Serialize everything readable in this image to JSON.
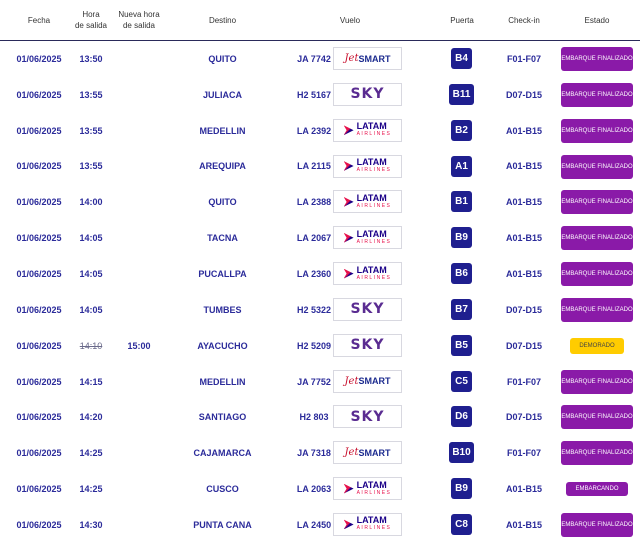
{
  "header": {
    "fecha": "Fecha",
    "hora": "Hora\nde salida",
    "nueva_hora": "Nueva hora\nde salida",
    "destino": "Destino",
    "vuelo": "Vuelo",
    "puerta": "Puerta",
    "checkin": "Check-in",
    "estado": "Estado"
  },
  "airlines": {
    "jetsmart": {
      "jet": "Jet",
      "smart": "SMART"
    },
    "sky": {
      "name": "SKY"
    },
    "latam": {
      "name": "LATAM",
      "sub": "AIRLINES"
    }
  },
  "colors": {
    "accent": "#2b2b9a",
    "status_purple": "#8a1aa8",
    "status_yellow": "#ffcc00",
    "gate_bg": "#1f1f8f"
  },
  "flights": [
    {
      "fecha": "01/06/2025",
      "hora": "13:50",
      "nueva_hora": "",
      "destino": "QUITO",
      "vuelo": "JA 7742",
      "airline": "jetsmart",
      "puerta": "B4",
      "checkin": "F01-F07",
      "estado": "EMBARQUE FINALIZADO",
      "estado_type": "finalizado"
    },
    {
      "fecha": "01/06/2025",
      "hora": "13:55",
      "nueva_hora": "",
      "destino": "JULIACA",
      "vuelo": "H2 5167",
      "airline": "sky",
      "puerta": "B11",
      "checkin": "D07-D15",
      "estado": "EMBARQUE FINALIZADO",
      "estado_type": "finalizado"
    },
    {
      "fecha": "01/06/2025",
      "hora": "13:55",
      "nueva_hora": "",
      "destino": "MEDELLIN",
      "vuelo": "LA 2392",
      "airline": "latam",
      "puerta": "B2",
      "checkin": "A01-B15",
      "estado": "EMBARQUE FINALIZADO",
      "estado_type": "finalizado"
    },
    {
      "fecha": "01/06/2025",
      "hora": "13:55",
      "nueva_hora": "",
      "destino": "AREQUIPA",
      "vuelo": "LA 2115",
      "airline": "latam",
      "puerta": "A1",
      "checkin": "A01-B15",
      "estado": "EMBARQUE FINALIZADO",
      "estado_type": "finalizado"
    },
    {
      "fecha": "01/06/2025",
      "hora": "14:00",
      "nueva_hora": "",
      "destino": "QUITO",
      "vuelo": "LA 2388",
      "airline": "latam",
      "puerta": "B1",
      "checkin": "A01-B15",
      "estado": "EMBARQUE FINALIZADO",
      "estado_type": "finalizado"
    },
    {
      "fecha": "01/06/2025",
      "hora": "14:05",
      "nueva_hora": "",
      "destino": "TACNA",
      "vuelo": "LA 2067",
      "airline": "latam",
      "puerta": "B9",
      "checkin": "A01-B15",
      "estado": "EMBARQUE FINALIZADO",
      "estado_type": "finalizado"
    },
    {
      "fecha": "01/06/2025",
      "hora": "14:05",
      "nueva_hora": "",
      "destino": "PUCALLPA",
      "vuelo": "LA 2360",
      "airline": "latam",
      "puerta": "B6",
      "checkin": "A01-B15",
      "estado": "EMBARQUE FINALIZADO",
      "estado_type": "finalizado"
    },
    {
      "fecha": "01/06/2025",
      "hora": "14:05",
      "nueva_hora": "",
      "destino": "TUMBES",
      "vuelo": "H2 5322",
      "airline": "sky",
      "puerta": "B7",
      "checkin": "D07-D15",
      "estado": "EMBARQUE FINALIZADO",
      "estado_type": "finalizado"
    },
    {
      "fecha": "01/06/2025",
      "hora": "14:10",
      "nueva_hora": "15:00",
      "destino": "AYACUCHO",
      "vuelo": "H2 5209",
      "airline": "sky",
      "puerta": "B5",
      "checkin": "D07-D15",
      "estado": "DEMORADO",
      "estado_type": "demorado"
    },
    {
      "fecha": "01/06/2025",
      "hora": "14:15",
      "nueva_hora": "",
      "destino": "MEDELLIN",
      "vuelo": "JA 7752",
      "airline": "jetsmart",
      "puerta": "C5",
      "checkin": "F01-F07",
      "estado": "EMBARQUE FINALIZADO",
      "estado_type": "finalizado"
    },
    {
      "fecha": "01/06/2025",
      "hora": "14:20",
      "nueva_hora": "",
      "destino": "SANTIAGO",
      "vuelo": "H2 803",
      "airline": "sky",
      "puerta": "D6",
      "checkin": "D07-D15",
      "estado": "EMBARQUE FINALIZADO",
      "estado_type": "finalizado"
    },
    {
      "fecha": "01/06/2025",
      "hora": "14:25",
      "nueva_hora": "",
      "destino": "CAJAMARCA",
      "vuelo": "JA 7318",
      "airline": "jetsmart",
      "puerta": "B10",
      "checkin": "F01-F07",
      "estado": "EMBARQUE FINALIZADO",
      "estado_type": "finalizado"
    },
    {
      "fecha": "01/06/2025",
      "hora": "14:25",
      "nueva_hora": "",
      "destino": "CUSCO",
      "vuelo": "LA 2063",
      "airline": "latam",
      "puerta": "B9",
      "checkin": "A01-B15",
      "estado": "EMBARCANDO",
      "estado_type": "embarcando"
    },
    {
      "fecha": "01/06/2025",
      "hora": "14:30",
      "nueva_hora": "",
      "destino": "PUNTA CANA",
      "vuelo": "LA 2450",
      "airline": "latam",
      "puerta": "C8",
      "checkin": "A01-B15",
      "estado": "EMBARQUE FINALIZADO",
      "estado_type": "finalizado"
    }
  ]
}
